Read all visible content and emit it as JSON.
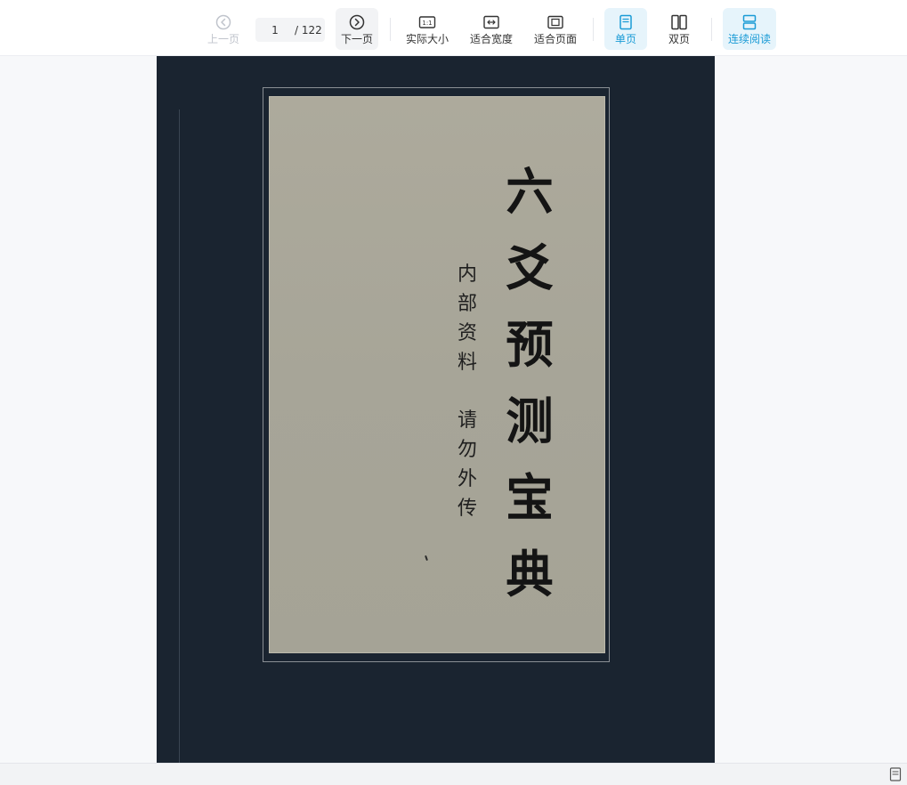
{
  "toolbar": {
    "prev_label": "上一页",
    "next_label": "下一页",
    "current_page": "1",
    "total_pages": "/ 122",
    "actual_size_label": "实际大小",
    "fit_width_label": "适合宽度",
    "fit_page_label": "适合页面",
    "single_page_label": "单页",
    "double_page_label": "双页",
    "continuous_label": "连续阅读",
    "actual_size_icon_text": "1:1"
  },
  "document": {
    "title_chars": [
      "六",
      "爻",
      "预",
      "测",
      "宝",
      "典"
    ],
    "subtitle_line1": [
      "内",
      "部",
      "资",
      "料"
    ],
    "subtitle_line2": [
      "请",
      "勿",
      "外",
      "传"
    ]
  },
  "colors": {
    "accent": "#1a9bd6",
    "cover_dark": "#1a2430",
    "cover_label": "#a9a79a"
  }
}
